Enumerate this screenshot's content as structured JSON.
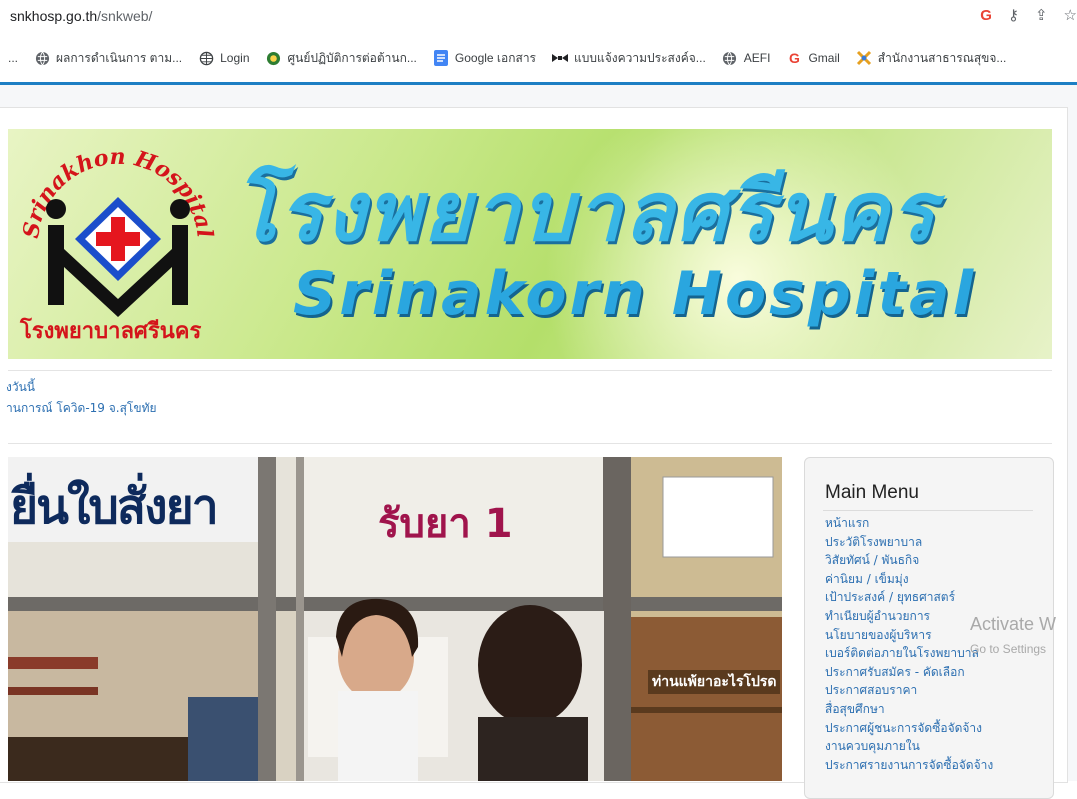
{
  "browser": {
    "url_host": "snkhosp.go.th",
    "url_path": "/snkweb/",
    "bookmarks": [
      {
        "label": "...",
        "icon": "more"
      },
      {
        "label": "ผลการดำเนินการ ตาม...",
        "icon": "globe-icon"
      },
      {
        "label": "Login",
        "icon": "web-icon"
      },
      {
        "label": "ศูนย์ปฏิบัติการต่อต้านก...",
        "icon": "site-icon"
      },
      {
        "label": "Google เอกสาร",
        "icon": "docs-icon"
      },
      {
        "label": "แบบแจ้งความประสงค์จ...",
        "icon": "form-icon"
      },
      {
        "label": "AEFI",
        "icon": "globe-icon"
      },
      {
        "label": "Gmail",
        "icon": "google-icon"
      },
      {
        "label": "สำนักงานสาธารณสุขจ...",
        "icon": "office-icon"
      }
    ]
  },
  "banner": {
    "thai_title": "โรงพยาบาลศรีนคร",
    "english_title": "Srinakorn Hospital",
    "logo_arc_text": "Srinakhon Hospital",
    "logo_caption": "โรงพยาบาลศรีนคร"
  },
  "news": {
    "line1": "งวันนี้",
    "line2": "านการณ์ โควิด-19 จ.สุโขทัย"
  },
  "photo": {
    "sign1": "ยื่นใบสั่งยา",
    "sign2": "รับยา 1",
    "sign3": "ท่านแพ้ยาอะไรโปรด"
  },
  "menu": {
    "title": "Main Menu",
    "items": [
      "หน้าแรก",
      "ประวัติโรงพยาบาล",
      "วิสัยทัศน์ / พันธกิจ",
      "ค่านิยม / เข็มมุ่ง",
      "เป้าประสงค์ / ยุทธศาสตร์",
      "ทำเนียบผู้อำนวยการ",
      "นโยบายของผู้บริหาร",
      "เบอร์ติดต่อภายในโรงพยาบาล",
      "ประกาศรับสมัคร - คัดเลือก",
      "ประกาศสอบราคา",
      "สื่อสุขศึกษา",
      "ประกาศผู้ชนะการจัดซื้อจัดจ้าง",
      "งานควบคุมภายใน",
      "ประกาศรายงานการจัดซื้อจัดจ้าง"
    ]
  },
  "watermark": {
    "line1": "Activate W",
    "line2": "Go to Settings"
  },
  "colors": {
    "accent_blue": "#1d7fc4",
    "link": "#2c6fb1",
    "title_blue": "#38b6e6",
    "logo_red": "#d4141b"
  }
}
